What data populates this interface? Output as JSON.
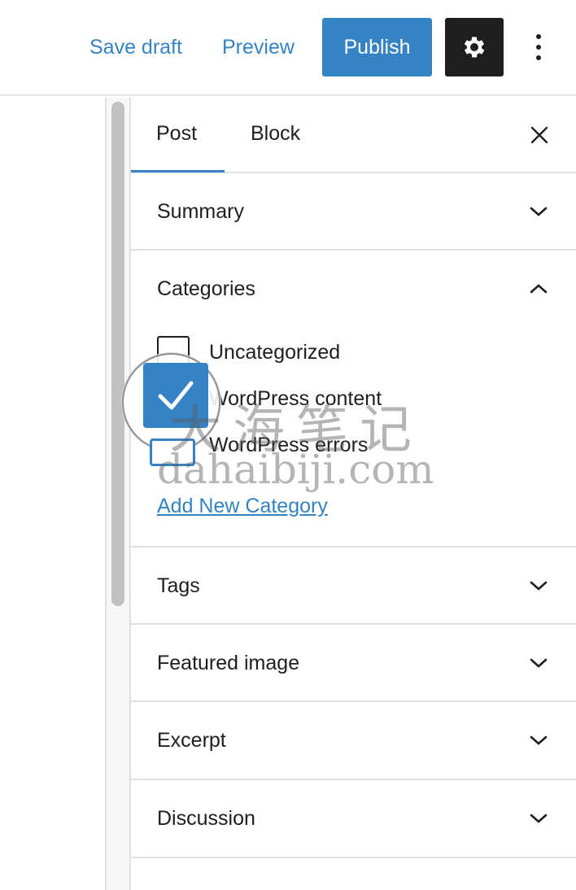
{
  "toolbar": {
    "save_draft_label": "Save draft",
    "preview_label": "Preview",
    "publish_label": "Publish",
    "settings_icon": "gear-icon",
    "more_icon": "vertical-ellipsis-icon"
  },
  "sidebar": {
    "tabs": [
      {
        "label": "Post",
        "active": true
      },
      {
        "label": "Block",
        "active": false
      }
    ],
    "close_icon": "close-icon",
    "panels": {
      "summary": {
        "title": "Summary",
        "expanded": false
      },
      "categories": {
        "title": "Categories",
        "expanded": true,
        "items": [
          {
            "label": "Uncategorized",
            "checked": false
          },
          {
            "label": "WordPress content",
            "checked": true
          },
          {
            "label": "WordPress errors",
            "checked": false
          }
        ],
        "add_new_label": "Add New Category"
      },
      "tags": {
        "title": "Tags",
        "expanded": false
      },
      "featured_image": {
        "title": "Featured image",
        "expanded": false
      },
      "excerpt": {
        "title": "Excerpt",
        "expanded": false
      },
      "discussion": {
        "title": "Discussion",
        "expanded": false
      }
    }
  },
  "watermark": {
    "chinese": "大海笔记",
    "domain": "dahaibiji.com"
  },
  "colors": {
    "accent": "#3582c4",
    "dark": "#1e1e1e",
    "border": "#e0e0e0"
  }
}
